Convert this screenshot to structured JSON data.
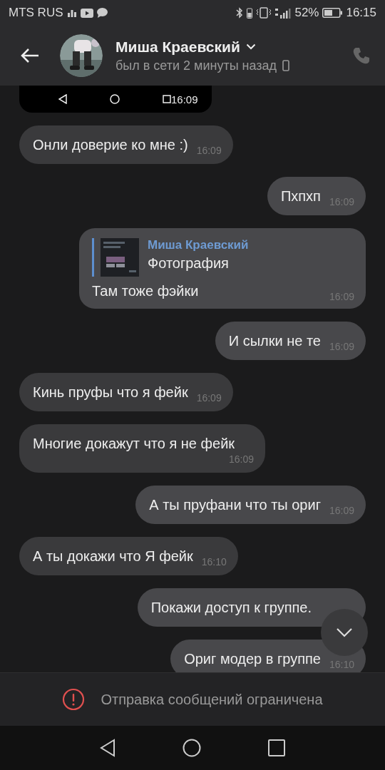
{
  "status_bar": {
    "carrier": "MTS RUS",
    "battery": "52%",
    "time": "16:15"
  },
  "header": {
    "name": "Миша Краевский",
    "status": "был в сети 2 минуты назад"
  },
  "messages": [
    {
      "outgoing": false,
      "time": "16:09"
    },
    {
      "kind": "text",
      "outgoing": false,
      "text": "Онли доверие ко мне :)",
      "time": "16:09"
    },
    {
      "kind": "text",
      "outgoing": true,
      "text": "Пхпхп",
      "time": "16:09"
    },
    {
      "kind": "reply",
      "outgoing": true,
      "reply_author": "Миша Краевский",
      "reply_text": "Фотография",
      "text": "Там тоже фэйки",
      "time": "16:09"
    },
    {
      "kind": "text",
      "outgoing": true,
      "text": "И сылки не те",
      "time": "16:09"
    },
    {
      "kind": "text",
      "outgoing": false,
      "text": "Кинь пруфы что я фейк",
      "time": "16:09"
    },
    {
      "kind": "text",
      "outgoing": false,
      "text": "Многие докажут что я не фейк",
      "time": "16:09"
    },
    {
      "kind": "text",
      "outgoing": true,
      "text": "А ты пруфани что ты ориг",
      "time": "16:09"
    },
    {
      "kind": "text",
      "outgoing": false,
      "text": "А ты докажи что Я фейк",
      "time": "16:10"
    },
    {
      "kind": "text",
      "outgoing": true,
      "text": "Покажи доступ к группе."
    },
    {
      "kind": "text",
      "outgoing": true,
      "text": "Ориг модер в группе",
      "time": "16:10"
    }
  ],
  "notice": "Отправка сообщений ограничена"
}
